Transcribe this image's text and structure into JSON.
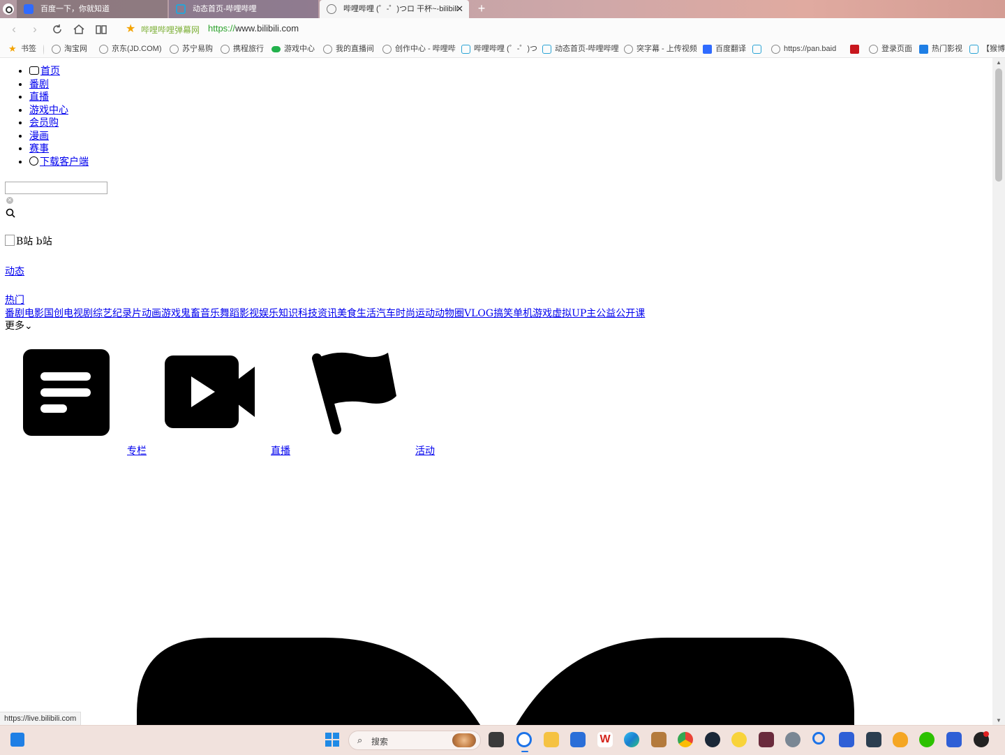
{
  "browser": {
    "tabs": [
      {
        "title": "百度一下，你就知道",
        "icon": "baidu-icon"
      },
      {
        "title": "动态首页-哔哩哔哩",
        "icon": "bilibili-icon"
      },
      {
        "title": "哔哩哔哩 (゜-゜)つロ 干杯~-bilibili",
        "icon": "globe-icon",
        "active": true
      }
    ],
    "new_tab_symbol": "+",
    "close_symbol": "✕",
    "site_name": "哔哩哔哩弹幕网",
    "url_protocol": "https://",
    "url_host": "www.bilibili.com"
  },
  "bookmarks": [
    {
      "label": "书签",
      "icon": "star"
    },
    {
      "label": "淘宝网",
      "icon": "globe"
    },
    {
      "label": "京东(JD.COM)",
      "icon": "globe"
    },
    {
      "label": "苏宁易购",
      "icon": "globe"
    },
    {
      "label": "携程旅行",
      "icon": "globe"
    },
    {
      "label": "游戏中心",
      "icon": "game"
    },
    {
      "label": "我的直播间",
      "icon": "globe"
    },
    {
      "label": "创作中心 - 哔哩哔",
      "icon": "globe"
    },
    {
      "label": "哔哩哔哩 (゜-゜)つ",
      "icon": "bili"
    },
    {
      "label": "动态首页-哔哩哔哩",
      "icon": "bili"
    },
    {
      "label": "突字幕 - 上传视频",
      "icon": "globe"
    },
    {
      "label": "百度翻译",
      "icon": "trans"
    },
    {
      "label": "",
      "icon": "bili"
    },
    {
      "label": "https://pan.baid",
      "icon": "globe"
    },
    {
      "label": "",
      "icon": "red"
    },
    {
      "label": "登录页面",
      "icon": "globe"
    },
    {
      "label": "热门影视",
      "icon": "blue"
    },
    {
      "label": "【猴博",
      "icon": "bili"
    }
  ],
  "page": {
    "nav_items": [
      "首页",
      "番剧",
      "直播",
      "游戏中心",
      "会员购",
      "漫画",
      "赛事",
      "下载客户端"
    ],
    "search_placeholder": "",
    "clear_symbol": "✕",
    "logo_alt": "B站 b站",
    "dynamic_link": "动态",
    "hot_link": "热门",
    "categories": [
      "番剧",
      "电影",
      "国创",
      "电视剧",
      "综艺",
      "纪录片",
      "动画",
      "游戏",
      "鬼畜",
      "音乐",
      "舞蹈",
      "影视",
      "娱乐",
      "知识",
      "科技",
      "资讯",
      "美食",
      "生活",
      "汽车",
      "时尚",
      "运动",
      "动物圈",
      "VLOG",
      "搞笑",
      "单机游戏",
      "虚拟UP主",
      "公益",
      "公开课"
    ],
    "more_label": "更多",
    "more_symbol": "⌄",
    "features": [
      {
        "label": "专栏",
        "icon": "article-icon"
      },
      {
        "label": "直播",
        "icon": "live-video-icon"
      },
      {
        "label": "活动",
        "icon": "flag-icon"
      }
    ]
  },
  "status_url": "https://live.bilibili.com",
  "taskbar": {
    "search_label": "搜索",
    "apps": [
      "file-manager-icon",
      "browser-icon",
      "folder-icon",
      "store-icon",
      "wps-icon",
      "edge-icon",
      "package-icon",
      "chrome-icon",
      "steam-icon",
      "music-icon",
      "game-icon",
      "settings-icon",
      "search-app-icon",
      "shield-icon",
      "photo-app-icon",
      "fire-icon",
      "wechat-icon",
      "shield-app-icon",
      "obs-icon"
    ]
  }
}
